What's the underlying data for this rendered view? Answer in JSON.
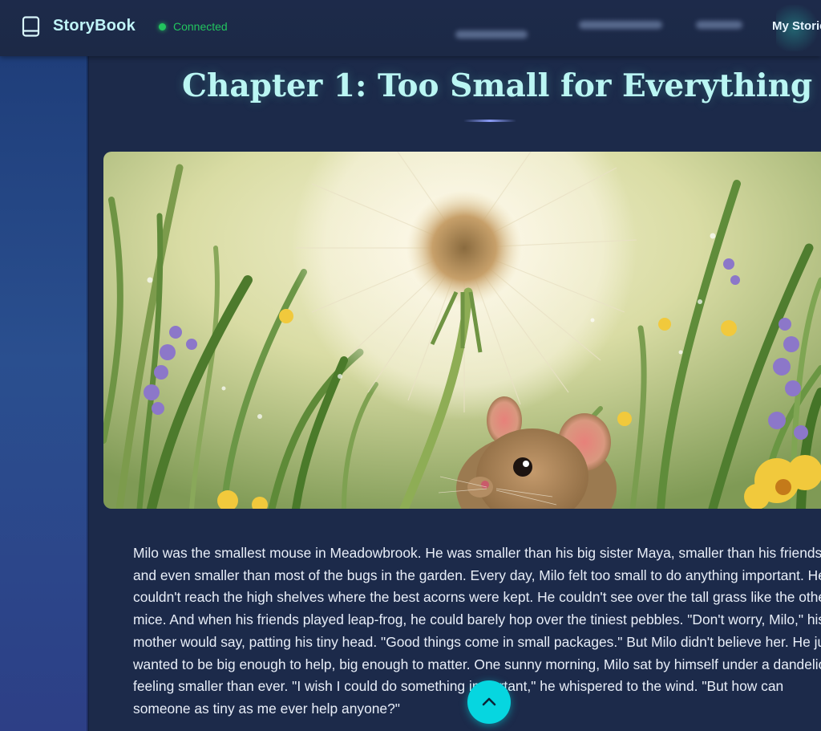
{
  "app": {
    "name": "StoryBook",
    "status": "Connected"
  },
  "nav": {
    "link_label": "My Stories"
  },
  "chapter": {
    "title": "Chapter 1: Too Small for Everything"
  },
  "story": {
    "text": "Milo was the smallest mouse in Meadowbrook. He was smaller than his big sister Maya, smaller than his friends, and even smaller than most of the bugs in the garden. Every day, Milo felt too small to do anything important. He couldn't reach the high shelves where the best acorns were kept. He couldn't see over the tall grass like the other mice. And when his friends played leap-frog, he could barely hop over the tiniest pebbles. \"Don't worry, Milo,\" his mother would say, patting his tiny head. \"Good things come in small packages.\" But Milo didn't believe her. He just wanted to be big enough to help, big enough to matter. One sunny morning, Milo sat by himself under a dandelion, feeling smaller than ever. \"I wish I could do something important,\" he whispered to the wind. \"But how can someone as tiny as me ever help anyone?\""
  },
  "icons": {
    "brand": "book-icon",
    "scroll_top": "chevron-up-icon"
  },
  "colors": {
    "accent": "#06d6e0",
    "status": "#22c55e",
    "title": "#baf6f3"
  }
}
